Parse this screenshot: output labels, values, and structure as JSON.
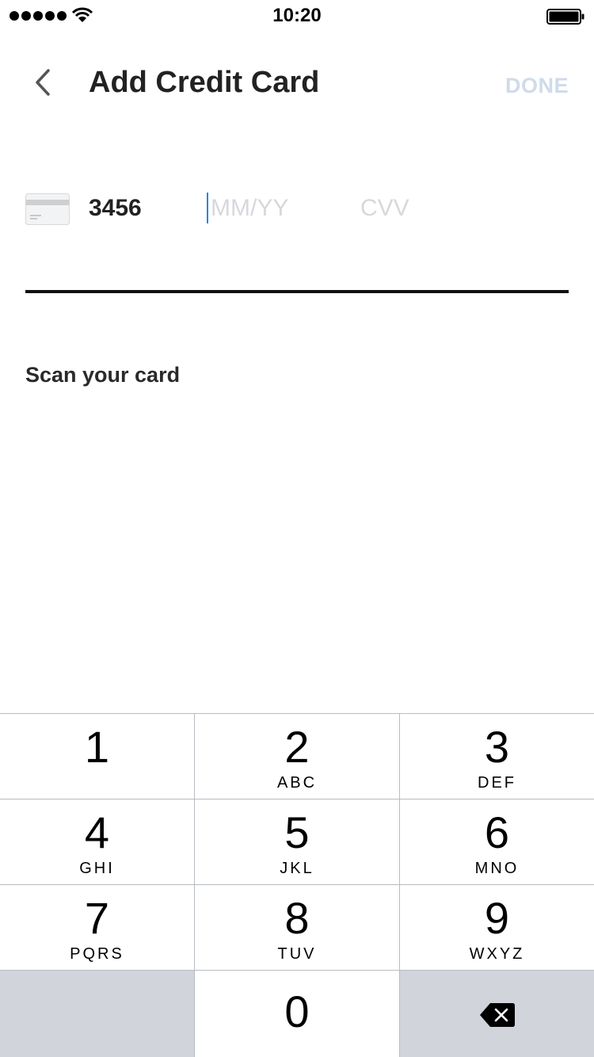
{
  "status_bar": {
    "time": "10:20"
  },
  "header": {
    "title": "Add Credit Card",
    "done_label": "DONE"
  },
  "card_form": {
    "card_number_last4": "3456",
    "expiry_placeholder": "MM/YY",
    "cvv_placeholder": "CVV",
    "scan_label": "Scan your card"
  },
  "keypad": {
    "keys": [
      {
        "digit": "1",
        "letters": ""
      },
      {
        "digit": "2",
        "letters": "ABC"
      },
      {
        "digit": "3",
        "letters": "DEF"
      },
      {
        "digit": "4",
        "letters": "GHI"
      },
      {
        "digit": "5",
        "letters": "JKL"
      },
      {
        "digit": "6",
        "letters": "MNO"
      },
      {
        "digit": "7",
        "letters": "PQRS"
      },
      {
        "digit": "8",
        "letters": "TUV"
      },
      {
        "digit": "9",
        "letters": "WXYZ"
      },
      {
        "digit": "0",
        "letters": ""
      }
    ]
  },
  "icons": {
    "back": "chevron-left-icon",
    "card": "credit-card-icon",
    "delete": "backspace-icon"
  },
  "colors": {
    "done_disabled": "#cfdbeb",
    "caret": "#2f80ed",
    "placeholder": "#d6d8dc",
    "keypad_gray": "#d1d5db"
  }
}
